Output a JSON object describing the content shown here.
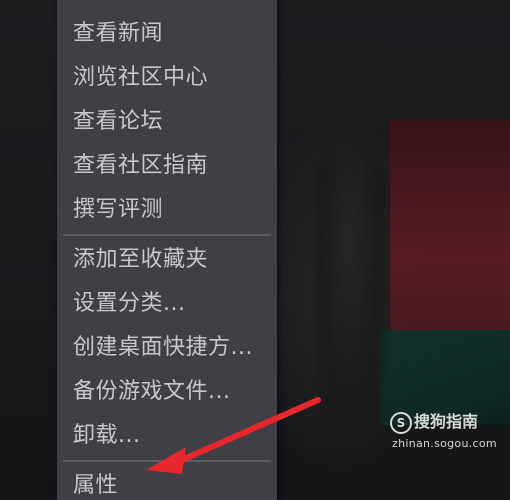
{
  "context_menu": {
    "items": [
      {
        "label": "查看新闻"
      },
      {
        "label": "浏览社区中心"
      },
      {
        "label": "查看论坛"
      },
      {
        "label": "查看社区指南"
      },
      {
        "label": "撰写评测"
      },
      {
        "label": "添加至收藏夹"
      },
      {
        "label": "设置分类..."
      },
      {
        "label": "创建桌面快捷方..."
      },
      {
        "label": "备份游戏文件..."
      },
      {
        "label": "卸载..."
      },
      {
        "label": "属性"
      }
    ]
  },
  "annotation": {
    "arrow_color": "#e8262b",
    "pointing_to": "属性"
  },
  "watermark": {
    "icon": "sogou-s-icon",
    "icon_glyph": "S",
    "title": "搜狗指南",
    "url": "zhinan.sogou.com"
  }
}
